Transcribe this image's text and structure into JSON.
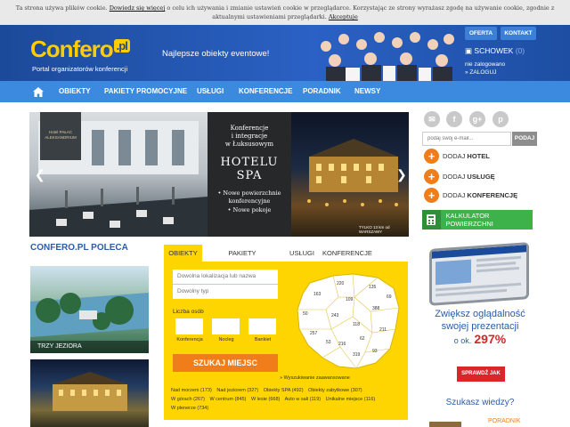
{
  "cookie": {
    "text1": "Ta strona używa plików cookie.",
    "link1": "Dowiedz się więcej",
    "text2": "o celu ich używania i zmianie ustawień cookie w przeglądarce. Korzystając ze strony wyrażasz zgodę na używanie cookie, zgodnie z aktualnymi ustawieniami przeglądarki.",
    "accept": "Akceptuje"
  },
  "header": {
    "logo_main": "Confero",
    "logo_pl": ".pl",
    "logo_sub": "Portal organizatorów konferencji",
    "tagline": "Najlepsze obiekty eventowe!",
    "oferta": "OFERTA",
    "kontakt": "KONTAKT",
    "schowek": "SCHOWEK",
    "schowek_count": "(0)",
    "login_status": "nie zalogowano",
    "login_link": "» ZALOGUJ"
  },
  "nav": {
    "items": [
      "OBIEKTY",
      "PAKIETY PROMOCYJNE",
      "USŁUGI",
      "KONFERENCJE",
      "PORADNIK",
      "NEWSY"
    ]
  },
  "slider": {
    "badge": "Hotel PAŁAC ALEKSANDRIUM",
    "line1": "Konferencje",
    "line2": "i integracje",
    "line3": "w Łuksusowym",
    "hotel": "HOTELU",
    "spa": "SPA",
    "bullet1": "• Nowe powierzchnie konferencyjne",
    "bullet2": "• Nowe pokoje",
    "promo": "TYLKO 13 km od WARSZAWY"
  },
  "sidebar": {
    "email_placeholder": "podaj swój e-mail...",
    "email_button": "PODAJ",
    "add_hotel_prefix": "DODAJ",
    "add_hotel": "HOTEL",
    "add_service_prefix": "DODAJ",
    "add_service": "USŁUGĘ",
    "add_conf_prefix": "DODAJ",
    "add_conf": "KONFERENCJĘ",
    "calculator": "KALKULATOR POWIERZCHNI"
  },
  "poleca": {
    "title": "CONFERO.PL POLECA",
    "item1": "TRZY JEZIORA"
  },
  "search": {
    "tabs": [
      "OBIEKTY",
      "PAKIETY PROMOCYJNE",
      "USŁUGI",
      "KONFERENCJE"
    ],
    "location_placeholder": "Dowolna lokalizacja lub nazwa",
    "type_placeholder": "Dowolny typ",
    "people_label": "Liczba osób",
    "sub_labels": [
      "Konferencja",
      "Nocleg",
      "Bankiet"
    ],
    "button": "SZUKAJ MIEJSC",
    "advanced": "» Wyszukiwanie zaawansowane",
    "quick_links": [
      "Nad morzem (173)",
      "Nad jeziorem (327)",
      "Obiekty SPA (492)",
      "Obiekty zabytkowe (307)",
      "W górach (267)",
      "W centrum (845)",
      "W lesie (668)",
      "Auto w sali (119)",
      "Unikalne miejsce (116)",
      "W plenerze (734)"
    ],
    "map_numbers": [
      "220",
      "135",
      "163",
      "69",
      "109",
      "388",
      "50",
      "243",
      "118",
      "257",
      "211",
      "62",
      "53",
      "216",
      "319",
      "93"
    ]
  },
  "promo": {
    "line1": "Zwiększ oglądalność",
    "line2": "swojej prezentacji",
    "ok_prefix": "o ok.",
    "percent": "297%",
    "button": "SPRAWDŹ JAK",
    "szukasz": "Szukasz wiedzy?",
    "poradnik": "PORADNIK"
  },
  "colors": {
    "header_blue": "#1c4a9a",
    "nav_blue": "#3b8ae0",
    "accent_yellow": "#ffd500",
    "accent_orange": "#f07d1a",
    "accent_red": "#d9262b",
    "calc_green": "#3db24a"
  }
}
